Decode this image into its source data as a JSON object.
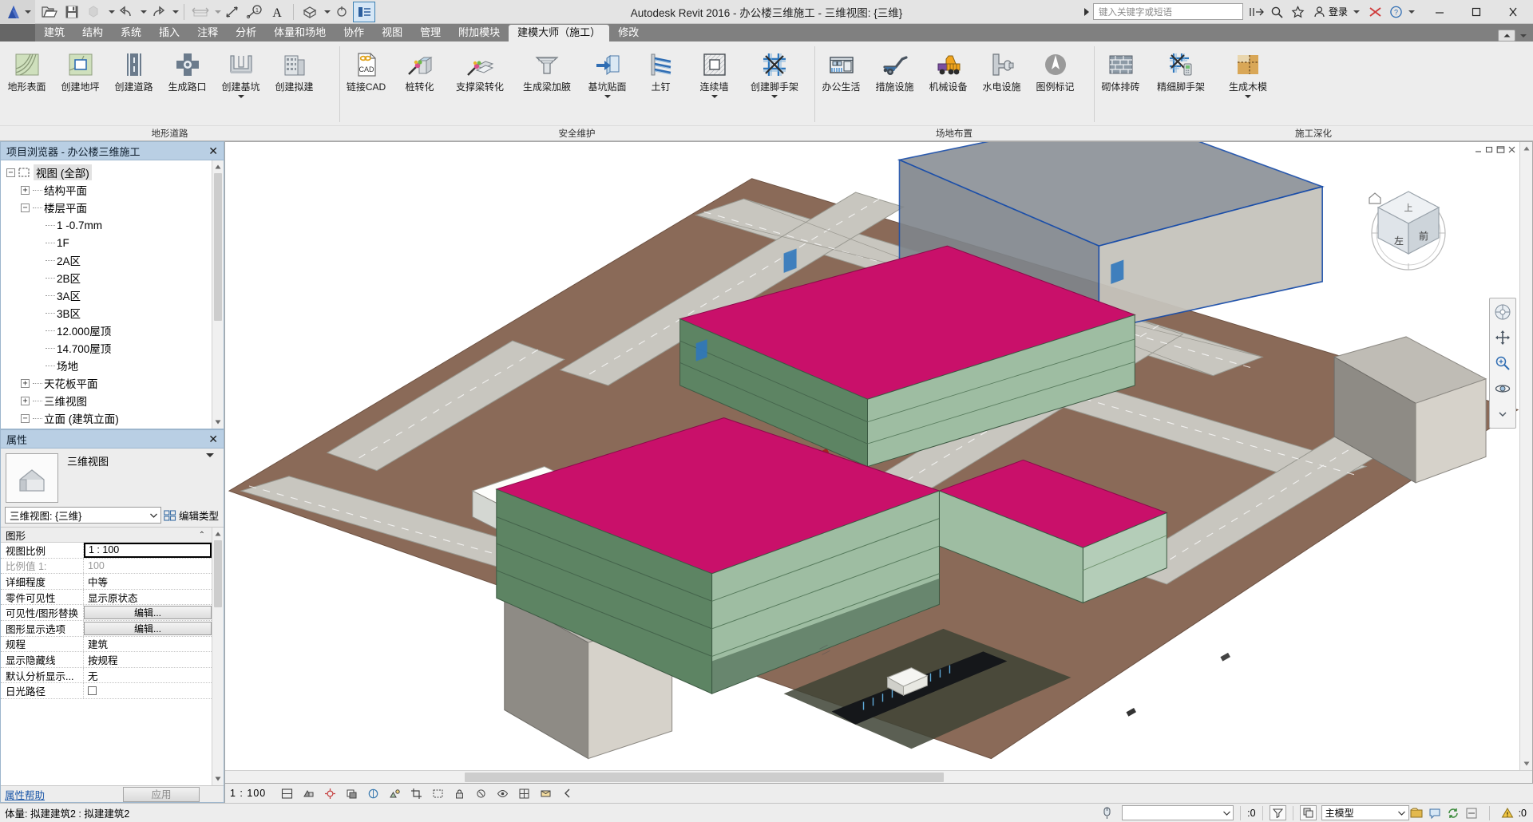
{
  "window": {
    "title": "Autodesk Revit 2016 -  办公楼三维施工 - 三维视图: {三维}",
    "search_placeholder": "键入关键字或短语",
    "login_label": "登录",
    "minimize": "−",
    "maximize": "□",
    "close": "✕"
  },
  "quick_access": {
    "open": "打开",
    "save": "保存",
    "export": "导出",
    "undo": "放弃",
    "redo": "重做",
    "measure": "测量",
    "align": "对齐尺寸标注",
    "tag": "按类别标记",
    "text": "文字",
    "default3d": "默认三维视图",
    "section": "剖面",
    "thinlines": "细线"
  },
  "ribbon": {
    "tabs": [
      {
        "label": "建筑",
        "active": false
      },
      {
        "label": "结构",
        "active": false
      },
      {
        "label": "系统",
        "active": false
      },
      {
        "label": "插入",
        "active": false
      },
      {
        "label": "注释",
        "active": false
      },
      {
        "label": "分析",
        "active": false
      },
      {
        "label": "体量和场地",
        "active": false
      },
      {
        "label": "协作",
        "active": false
      },
      {
        "label": "视图",
        "active": false
      },
      {
        "label": "管理",
        "active": false
      },
      {
        "label": "附加模块",
        "active": false
      },
      {
        "label": "建模大师（施工）",
        "active": true
      },
      {
        "label": "修改",
        "active": false
      }
    ],
    "panels": [
      {
        "name": "地形道路",
        "buttons": [
          {
            "label": "地形表面",
            "icon": "terrain-surface-icon",
            "dropdown": false
          },
          {
            "label": "创建地坪",
            "icon": "create-pad-icon",
            "dropdown": false
          },
          {
            "label": "创建道路",
            "icon": "create-road-icon",
            "dropdown": false
          },
          {
            "label": "生成路口",
            "icon": "generate-junction-icon",
            "dropdown": false
          },
          {
            "label": "创建基坑",
            "icon": "create-pit-icon",
            "dropdown": true
          },
          {
            "label": "创建拟建",
            "icon": "create-proposed-building-icon",
            "dropdown": false
          }
        ]
      },
      {
        "name": "安全维护",
        "buttons": [
          {
            "label": "链接CAD",
            "icon": "link-cad-icon",
            "dropdown": false
          },
          {
            "label": "桩转化",
            "icon": "pile-convert-icon",
            "dropdown": false
          },
          {
            "label": "支撑梁转化",
            "icon": "brace-beam-convert-icon",
            "dropdown": false
          },
          {
            "label": "生成梁加腋",
            "icon": "beam-haunch-icon",
            "dropdown": false
          },
          {
            "label": "基坑贴面",
            "icon": "pit-facing-icon",
            "dropdown": true
          },
          {
            "label": "土钉",
            "icon": "soil-nail-icon",
            "dropdown": false
          },
          {
            "label": "连续墙",
            "icon": "diaphragm-wall-icon",
            "dropdown": true
          },
          {
            "label": "创建脚手架",
            "icon": "create-scaffold-icon",
            "dropdown": true
          }
        ]
      },
      {
        "name": "场地布置",
        "buttons": [
          {
            "label": "办公生活",
            "icon": "office-living-icon",
            "dropdown": false
          },
          {
            "label": "措施设施",
            "icon": "measure-facility-icon",
            "dropdown": false
          },
          {
            "label": "机械设备",
            "icon": "machinery-icon",
            "dropdown": false
          },
          {
            "label": "水电设施",
            "icon": "utility-icon",
            "dropdown": false
          },
          {
            "label": "图例标记",
            "icon": "legend-mark-icon",
            "dropdown": false
          }
        ]
      },
      {
        "name": "施工深化",
        "buttons": [
          {
            "label": "砌体排砖",
            "icon": "masonry-layout-icon",
            "dropdown": false
          },
          {
            "label": "精细脚手架",
            "icon": "fine-scaffold-icon",
            "dropdown": false
          },
          {
            "label": "生成木模",
            "icon": "generate-formwork-icon",
            "dropdown": true
          }
        ]
      }
    ]
  },
  "browser": {
    "title": "项目浏览器 - 办公楼三维施工",
    "nodes": [
      {
        "label": "视图 (全部)",
        "depth": 0,
        "toggle": "minus",
        "icon": true,
        "selected": true
      },
      {
        "label": "结构平面",
        "depth": 1,
        "toggle": "plus",
        "icon": false,
        "selected": false
      },
      {
        "label": "楼层平面",
        "depth": 1,
        "toggle": "minus",
        "icon": false,
        "selected": false
      },
      {
        "label": "1 -0.7mm",
        "depth": 2,
        "toggle": "none",
        "icon": false,
        "selected": false
      },
      {
        "label": "1F",
        "depth": 2,
        "toggle": "none",
        "icon": false,
        "selected": false
      },
      {
        "label": "2A区",
        "depth": 2,
        "toggle": "none",
        "icon": false,
        "selected": false
      },
      {
        "label": "2B区",
        "depth": 2,
        "toggle": "none",
        "icon": false,
        "selected": false
      },
      {
        "label": "3A区",
        "depth": 2,
        "toggle": "none",
        "icon": false,
        "selected": false
      },
      {
        "label": "3B区",
        "depth": 2,
        "toggle": "none",
        "icon": false,
        "selected": false
      },
      {
        "label": "12.000屋顶",
        "depth": 2,
        "toggle": "none",
        "icon": false,
        "selected": false
      },
      {
        "label": "14.700屋顶",
        "depth": 2,
        "toggle": "none",
        "icon": false,
        "selected": false
      },
      {
        "label": "场地",
        "depth": 2,
        "toggle": "none",
        "icon": false,
        "selected": false
      },
      {
        "label": "天花板平面",
        "depth": 1,
        "toggle": "plus",
        "icon": false,
        "selected": false
      },
      {
        "label": "三维视图",
        "depth": 1,
        "toggle": "plus",
        "icon": false,
        "selected": false
      },
      {
        "label": "立面 (建筑立面)",
        "depth": 1,
        "toggle": "minus",
        "icon": false,
        "selected": false
      }
    ]
  },
  "properties": {
    "title": "属性",
    "type_label": "三维视图",
    "instance_selector": "三维视图: {三维}",
    "edit_type_label": "编辑类型",
    "group_label": "图形",
    "rows": [
      {
        "name": "视图比例",
        "value": "1 : 100",
        "kind": "framed"
      },
      {
        "name": "比例值 1:",
        "value": "100",
        "kind": "gray"
      },
      {
        "name": "详细程度",
        "value": "中等",
        "kind": "text"
      },
      {
        "name": "零件可见性",
        "value": "显示原状态",
        "kind": "text"
      },
      {
        "name": "可见性/图形替换",
        "value": "编辑...",
        "kind": "button"
      },
      {
        "name": "图形显示选项",
        "value": "编辑...",
        "kind": "button"
      },
      {
        "name": "规程",
        "value": "建筑",
        "kind": "text"
      },
      {
        "name": "显示隐藏线",
        "value": "按规程",
        "kind": "text"
      },
      {
        "name": "默认分析显示...",
        "value": "无",
        "kind": "text"
      },
      {
        "name": "日光路径",
        "value": "",
        "kind": "checkbox"
      }
    ],
    "help_link": "属性帮助",
    "apply_label": "应用"
  },
  "view": {
    "scale_label": "1 : 100",
    "viewcube_faces": {
      "top": "上",
      "front": "前",
      "left": "左"
    },
    "nav_tools": [
      "steering-wheel-icon",
      "pan-icon",
      "zoom-extents-icon",
      "orbit-icon"
    ],
    "toolbar_icons": [
      "scale-icon",
      "detail-level-icon",
      "visual-style-icon",
      "sun-path-icon",
      "shadows-icon",
      "rendering-icon",
      "crop-view-icon",
      "show-crop-icon",
      "lock-3d-icon",
      "temp-hide-icon",
      "reveal-hidden-icon",
      "analytical-model-icon",
      "worksharing-icon",
      "constraints-icon",
      "more-icon"
    ]
  },
  "status": {
    "message": "体量: 拟建建筑2 : 拟建建筑2",
    "filter_placeholder": "",
    "selection_count": ":0",
    "model_label": "主模型",
    "warning_count": ":0"
  },
  "colors": {
    "accent": "#3c7fb1",
    "panel_head": "#b9cfe4",
    "ribbon_bg": "#ededed",
    "tab_bar": "#808080",
    "terrain": "#8a6a58",
    "roof_magenta": "#c9106a",
    "building_green": "#7fa882",
    "building_dark": "#3c5c44",
    "mass_blue": "#1b4ea8",
    "road_gray": "#c8c6bf"
  }
}
